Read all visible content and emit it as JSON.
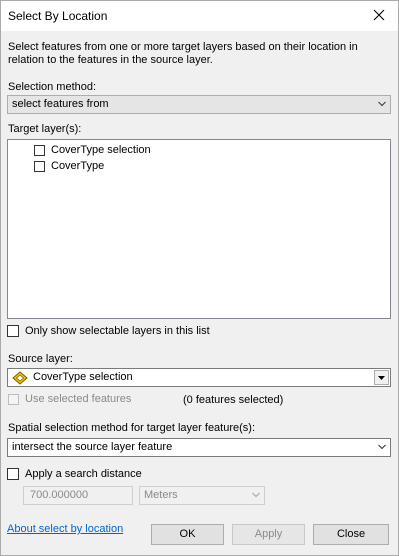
{
  "window": {
    "title": "Select By Location"
  },
  "description": "Select features from one or more target layers based on their location in relation to the features in the source layer.",
  "selection_method": {
    "label": "Selection method:",
    "value": "select features from"
  },
  "target_layers": {
    "label": "Target layer(s):",
    "items": [
      {
        "name": "CoverType selection",
        "checked": false
      },
      {
        "name": "CoverType",
        "checked": false
      }
    ]
  },
  "only_selectable": {
    "label": "Only show selectable layers in this list",
    "checked": false
  },
  "source_layer": {
    "label": "Source layer:",
    "value": "CoverType selection",
    "icon": "selection-layer-icon"
  },
  "use_selected": {
    "label": "Use selected features",
    "checked": false,
    "enabled": false
  },
  "features_selected": "(0 features selected)",
  "spatial_method": {
    "label": "Spatial selection method for target layer feature(s):",
    "value": "intersect the source layer feature"
  },
  "search_distance": {
    "label": "Apply a search distance",
    "checked": false,
    "value": "700.000000",
    "units": "Meters"
  },
  "footer": {
    "link": "About select by location",
    "ok": "OK",
    "apply": "Apply",
    "close": "Close"
  },
  "colors": {
    "link": "#0066cc",
    "window_bg": "#f0f0f0",
    "icon_yellow": "#f5c400"
  }
}
